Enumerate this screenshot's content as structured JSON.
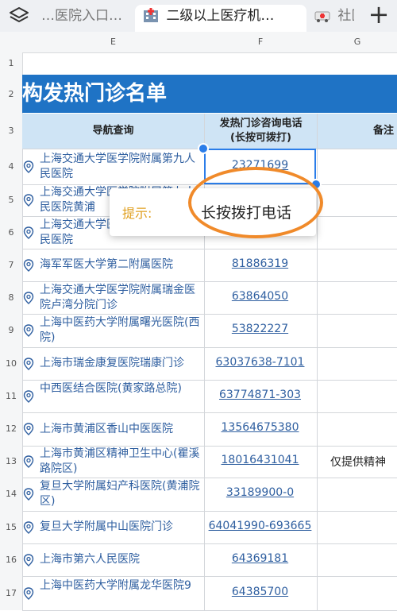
{
  "tabs": [
    {
      "label": "…医院入口…",
      "active": false
    },
    {
      "label": "二级以上医疗机…",
      "active": true
    },
    {
      "label": "社区",
      "active": false
    }
  ],
  "new_tab_label": "+",
  "columns": [
    "E",
    "F",
    "G"
  ],
  "row_numbers": [
    "1",
    "2",
    "3",
    "4",
    "5",
    "6",
    "7",
    "8",
    "9",
    "10",
    "11",
    "12",
    "13",
    "14",
    "15",
    "16",
    "17"
  ],
  "sheet_title": "构发热门诊名单",
  "headers": {
    "nav": "导航查询",
    "phone": "发热门诊咨询电话\n(长按可拨打)",
    "note": "备注"
  },
  "rows": [
    {
      "name": "上海交通大学医学院附属第九人民医院",
      "phone": "23271699",
      "note": ""
    },
    {
      "name": "上海交通大学医学院附属第九人民医院黄浦",
      "phone": "",
      "note": ""
    },
    {
      "name": "上海交通大学医学院附属第九人民医院",
      "phone": "",
      "note": ""
    },
    {
      "name": "海军军医大学第二附属医院",
      "phone": "81886319",
      "note": ""
    },
    {
      "name": "上海交通大学医学院附属瑞金医院卢湾分院门诊",
      "phone": "63864050",
      "note": ""
    },
    {
      "name": "上海中医药大学附属曙光医院(西院)",
      "phone": "53822227",
      "note": ""
    },
    {
      "name": "上海市瑞金康复医院瑞康门诊",
      "phone": "63037638-7101",
      "note": ""
    },
    {
      "name": "中西医结合医院(黄家路总院)",
      "phone": "63774871-303",
      "note": ""
    },
    {
      "name": "上海市黄浦区香山中医医院",
      "phone": "13564675380",
      "note": ""
    },
    {
      "name": "上海市黄浦区精神卫生中心(瞿溪路院区)",
      "phone": "18016431041",
      "note": "仅提供精神"
    },
    {
      "name": "复旦大学附属妇产科医院(黄浦院区)",
      "phone": "33189900-0",
      "note": ""
    },
    {
      "name": "复旦大学附属中山医院门诊",
      "phone": "64041990-693665",
      "note": ""
    },
    {
      "name": "上海市第六人民医院",
      "phone": "64369181",
      "note": ""
    },
    {
      "name": "上海中医药大学附属龙华医院9",
      "phone": "64385700",
      "note": ""
    }
  ],
  "tooltip": {
    "label": "提示:",
    "text": "长按拨打电话"
  },
  "colors": {
    "title_band": "#1f73c5",
    "header_fill": "#cfe4f5",
    "link": "#2f5fa0",
    "selection": "#2b7de9",
    "annotation_ring": "#f08a2a"
  }
}
